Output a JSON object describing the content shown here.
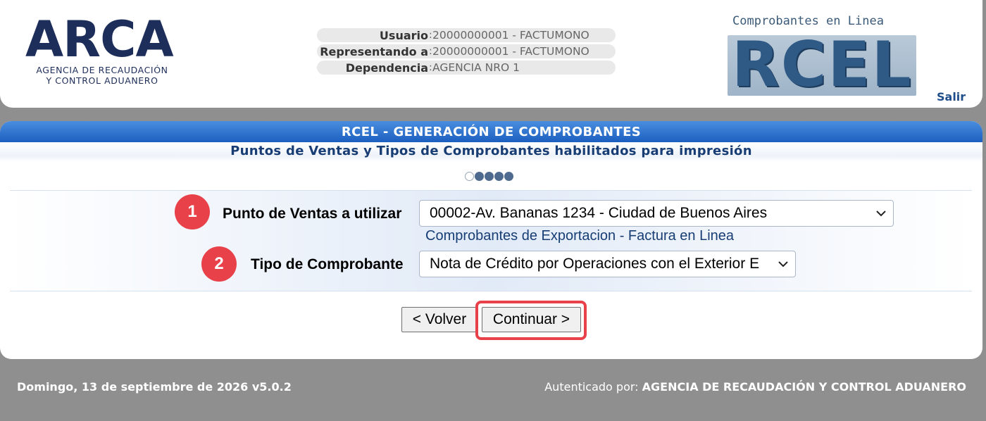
{
  "header": {
    "arca_logo": {
      "wordmark": "ARCA",
      "subtitle_line1": "AGENCIA DE RECAUDACIÓN",
      "subtitle_line2": "Y CONTROL ADUANERO"
    },
    "user_info": [
      {
        "label": "Usuario",
        "value": "20000000001 - FACTUMONO"
      },
      {
        "label": "Representando a",
        "value": "20000000001 - FACTUMONO"
      },
      {
        "label": "Dependencia",
        "value": "AGENCIA NRO 1"
      }
    ],
    "rcel_logo": {
      "caption": "Comprobantes en Linea",
      "wordmark": "RCEL"
    },
    "logout_label": "Salir"
  },
  "main": {
    "title": "RCEL - GENERACIÓN DE COMPROBANTES",
    "subtitle": "Puntos de Ventas y Tipos de Comprobantes habilitados para impresión",
    "progress": {
      "total_steps": 5,
      "current_step": 1
    },
    "form": {
      "punto_de_ventas": {
        "badge": "1",
        "label": "Punto de Ventas a utilizar",
        "selected": "00002-Av. Bananas 1234 - Ciudad de Buenos Aires",
        "helper": "Comprobantes de Exportacion - Factura en Linea"
      },
      "tipo_comprobante": {
        "badge": "2",
        "label": "Tipo de Comprobante",
        "selected": "Nota de Crédito por Operaciones con el Exterior E"
      }
    },
    "buttons": {
      "back": "< Volver",
      "continue": "Continuar >"
    },
    "highlight_color": "#e8414a"
  },
  "footer": {
    "date_version": "Domingo, 13 de septiembre de 2026 v5.0.2",
    "auth_prefix": "Autenticado por: ",
    "auth_entity": "AGENCIA DE RECAUDACIÓN Y CONTROL ADUANERO"
  },
  "colors": {
    "background": "#8f8f8f",
    "title_bar": "#1c5fbf",
    "navy": "#1e2e5a",
    "badge_red": "#e8414a"
  }
}
